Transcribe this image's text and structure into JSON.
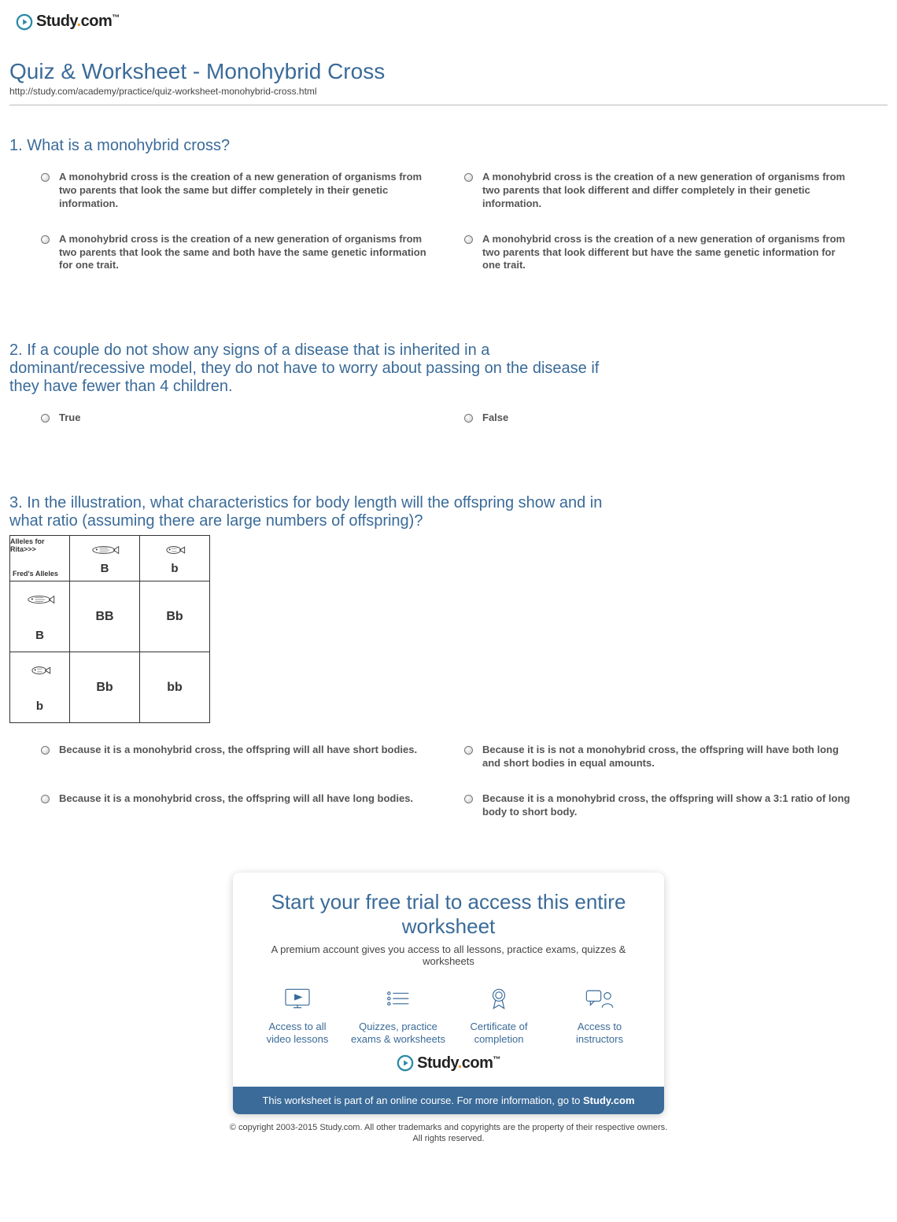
{
  "logo": {
    "text": "Study",
    "dot": ".",
    "suffix": "com",
    "tm": "™"
  },
  "title": "Quiz & Worksheet - Monohybrid Cross",
  "url": "http://study.com/academy/practice/quiz-worksheet-monohybrid-cross.html",
  "questions": [
    {
      "num": "1.",
      "text": "What is a monohybrid cross?",
      "options": [
        "A monohybrid cross is the creation of a new generation of organisms from two parents that look the same but differ completely in their genetic information.",
        "A monohybrid cross is the creation of a new generation of organisms from two parents that look different and differ completely in their genetic information.",
        "A monohybrid cross is the creation of a new generation of organisms from two parents that look the same and both have the same genetic information for one trait.",
        "A monohybrid cross is the creation of a new generation of organisms from two parents that look different but have the same genetic information for one trait."
      ]
    },
    {
      "num": "2.",
      "text": "If a couple do not show any signs of a disease that is inherited in a dominant/recessive model, they do not have to worry about passing on the disease if they have fewer than 4 children.",
      "options": [
        "True",
        "False"
      ]
    },
    {
      "num": "3.",
      "text": "In the illustration, what characteristics for body length will the offspring show and in what ratio (assuming there are large numbers of offspring)?",
      "options": [
        "Because it is a monohybrid cross, the offspring will all have short bodies.",
        "Because it is is not a monohybrid cross, the offspring will have both long and short bodies in equal amounts.",
        "Because it is a monohybrid cross, the offspring will all have long bodies.",
        "Because it is a monohybrid cross, the offspring will show a 3:1 ratio of long body to short body."
      ]
    }
  ],
  "punnett": {
    "rita_label": "Alleles for Rita>>>",
    "fred_label": "Fred's Alleles",
    "col_alleles": [
      "B",
      "b"
    ],
    "row_alleles": [
      "B",
      "b"
    ],
    "cells": [
      [
        "BB",
        "Bb"
      ],
      [
        "Bb",
        "bb"
      ]
    ]
  },
  "card": {
    "title": "Start your free trial to access this entire worksheet",
    "subtitle": "A premium account gives you access to all lessons, practice exams, quizzes & worksheets",
    "benefits": [
      {
        "line1": "Access to all",
        "line2": "video lessons"
      },
      {
        "line1": "Quizzes, practice",
        "line2": "exams & worksheets"
      },
      {
        "line1": "Certificate of",
        "line2": "completion"
      },
      {
        "line1": "Access to",
        "line2": "instructors"
      }
    ],
    "banner_pre": "This worksheet is part of an online course. For more information, go to ",
    "banner_link": "Study.com"
  },
  "copyright": {
    "line1": "© copyright 2003-2015 Study.com. All other trademarks and copyrights are the property of their respective owners.",
    "line2": "All rights reserved."
  }
}
